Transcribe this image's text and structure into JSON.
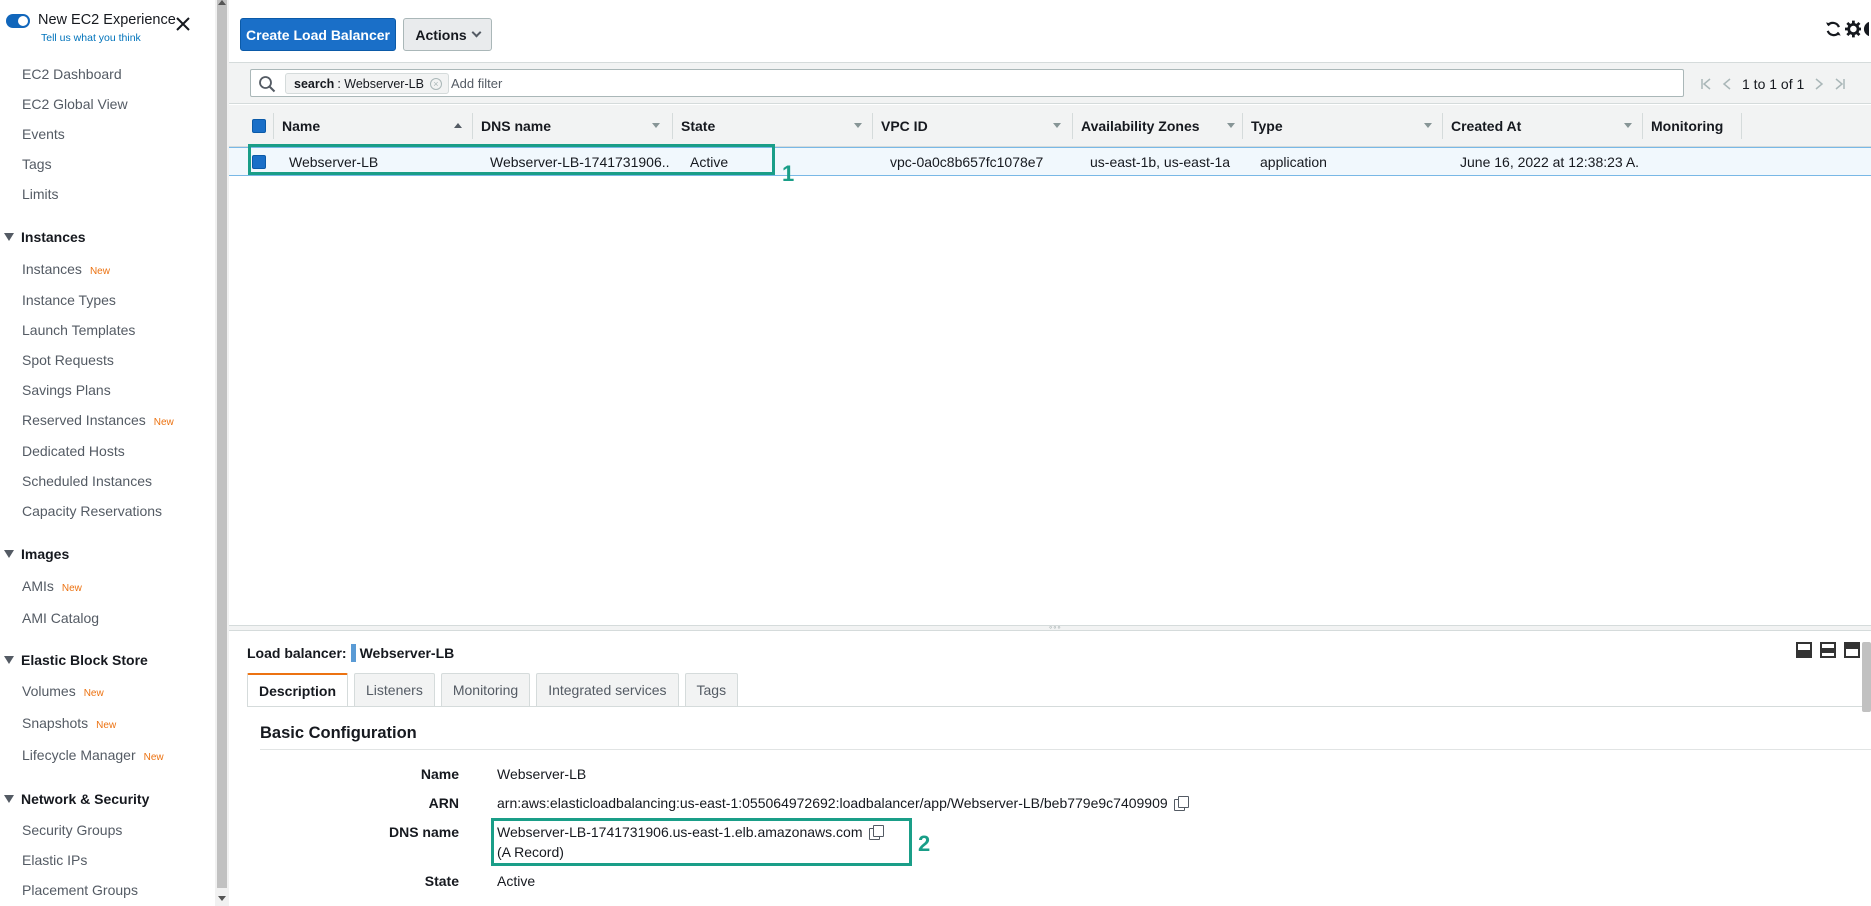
{
  "sidebar": {
    "toggle_title": "New EC2 Experience",
    "toggle_subtitle": "Tell us what you think",
    "items": [
      {
        "label": "EC2 Dashboard"
      },
      {
        "label": "EC2 Global View"
      },
      {
        "label": "Events"
      },
      {
        "label": "Tags"
      },
      {
        "label": "Limits"
      }
    ],
    "sections": [
      {
        "title": "Instances",
        "items": [
          {
            "label": "Instances",
            "badge": "New"
          },
          {
            "label": "Instance Types"
          },
          {
            "label": "Launch Templates"
          },
          {
            "label": "Spot Requests"
          },
          {
            "label": "Savings Plans"
          },
          {
            "label": "Reserved Instances",
            "badge": "New"
          },
          {
            "label": "Dedicated Hosts"
          },
          {
            "label": "Scheduled Instances"
          },
          {
            "label": "Capacity Reservations"
          }
        ]
      },
      {
        "title": "Images",
        "items": [
          {
            "label": "AMIs",
            "badge": "New"
          },
          {
            "label": "AMI Catalog"
          }
        ]
      },
      {
        "title": "Elastic Block Store",
        "items": [
          {
            "label": "Volumes",
            "badge": "New"
          },
          {
            "label": "Snapshots",
            "badge": "New"
          },
          {
            "label": "Lifecycle Manager",
            "badge": "New"
          }
        ]
      },
      {
        "title": "Network & Security",
        "items": [
          {
            "label": "Security Groups"
          },
          {
            "label": "Elastic IPs"
          },
          {
            "label": "Placement Groups"
          }
        ]
      }
    ]
  },
  "toolbar": {
    "create_label": "Create Load Balancer",
    "actions_label": "Actions"
  },
  "filter": {
    "chip_key": "search",
    "chip_value": ": Webserver-LB",
    "placeholder": "Add filter",
    "pagination": "1 to 1 of 1"
  },
  "table": {
    "columns": [
      "Name",
      "DNS name",
      "State",
      "VPC ID",
      "Availability Zones",
      "Type",
      "Created At",
      "Monitoring"
    ],
    "rows": [
      {
        "name": "Webserver-LB",
        "dns": "Webserver-LB-1741731906....",
        "state": "Active",
        "vpc": "vpc-0a0c8b657fc1078e7",
        "azs": "us-east-1b, us-east-1a",
        "type": "application",
        "created": "June 16, 2022 at 12:38:23 A..."
      }
    ]
  },
  "annotations": {
    "one": "1",
    "two": "2"
  },
  "detail": {
    "lb_label": "Load balancer:",
    "lb_name": "Webserver-LB",
    "tabs": [
      "Description",
      "Listeners",
      "Monitoring",
      "Integrated services",
      "Tags"
    ],
    "section_title": "Basic Configuration",
    "fields": {
      "name_label": "Name",
      "name_value": "Webserver-LB",
      "arn_label": "ARN",
      "arn_value": "arn:aws:elasticloadbalancing:us-east-1:055064972692:loadbalancer/app/Webserver-LB/beb779e9c7409909",
      "dns_label": "DNS name",
      "dns_value": "Webserver-LB-1741731906.us-east-1.elb.amazonaws.com",
      "dns_note": "(A Record)",
      "state_label": "State",
      "state_value": "Active"
    }
  },
  "colors": {
    "primary": "#1a6fc8",
    "annotation": "#1a9e88",
    "badge": "#ec7211"
  }
}
